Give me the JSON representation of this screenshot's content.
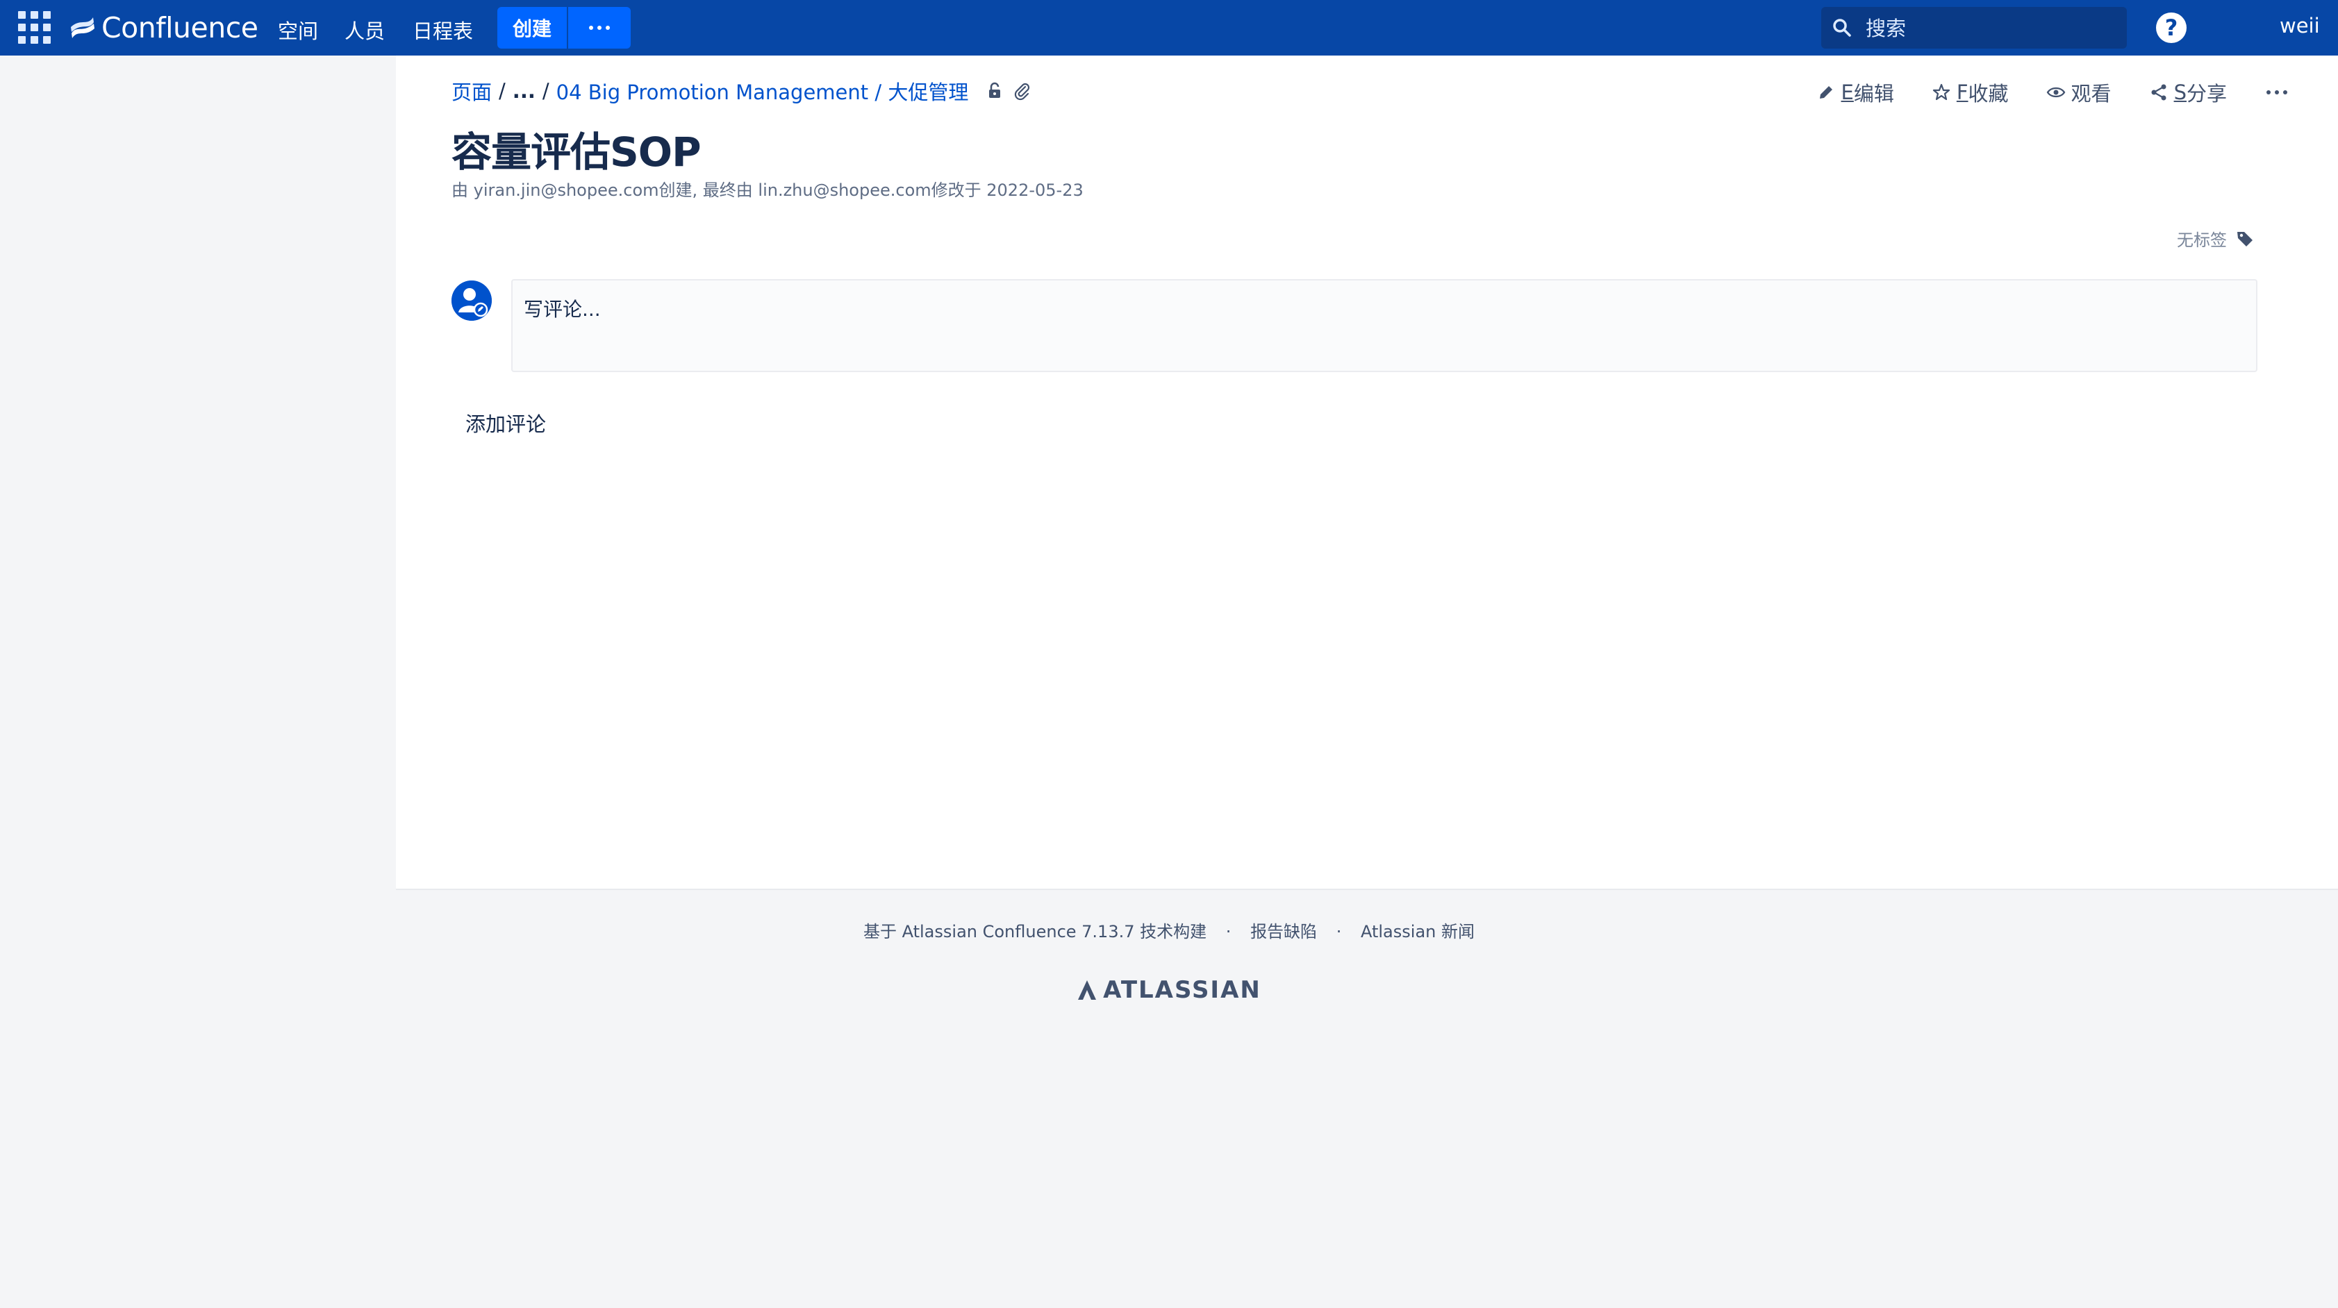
{
  "nav": {
    "logo": "Confluence",
    "spaces": "空间",
    "people": "人员",
    "calendar": "日程表",
    "create": "创建",
    "search_placeholder": "搜索",
    "help": "?",
    "user": "weii"
  },
  "breadcrumb": {
    "pages": "页面",
    "sep1": "/",
    "ellipsis": "...",
    "sep2": "/",
    "parent": "04 Big Promotion Management / 大促管理"
  },
  "actions": {
    "edit_key": "E",
    "edit": "编辑",
    "favorite_key": "F",
    "favorite": "收藏",
    "watch": "观看",
    "share_key": "S",
    "share": "分享"
  },
  "page": {
    "title": "容量评估SOP",
    "byline": "由 yiran.jin@shopee.com创建, 最终由 lin.zhu@shopee.com修改于 2022-05-23",
    "labels": "无标签"
  },
  "comments": {
    "placeholder": "写评论...",
    "add": "添加评论"
  },
  "footer": {
    "powered": "基于 Atlassian Confluence 7.13.7 技术构建",
    "dot1": "·",
    "bug": "报告缺陷",
    "dot2": "·",
    "news": "Atlassian 新闻",
    "brand": "ATLASSIAN"
  },
  "colors": {
    "nav_bg": "#0747a6",
    "create_bg": "#0065ff",
    "link": "#0052cc"
  },
  "icons": [
    "app-switcher-icon",
    "confluence-logo-icon",
    "search-icon",
    "help-icon",
    "restrictions-icon",
    "attachment-icon",
    "edit-icon",
    "star-icon",
    "eye-icon",
    "share-icon",
    "more-icon",
    "tag-icon",
    "avatar-icon",
    "atlassian-logo-icon"
  ]
}
